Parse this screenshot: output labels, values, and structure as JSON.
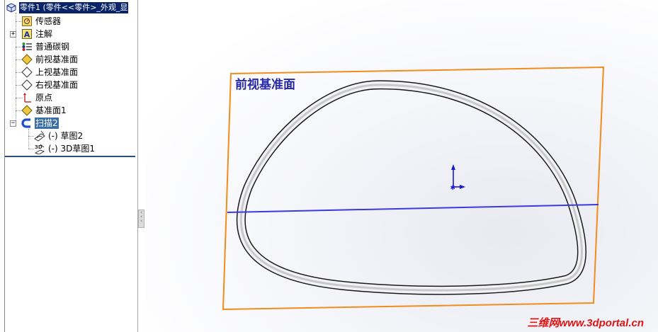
{
  "tree": {
    "root_label": "零件1  (零件<<零件>_外观_显",
    "items": [
      {
        "label": "传感器",
        "icon": "sensor-icon"
      },
      {
        "label": "注解",
        "icon": "annotation-icon"
      },
      {
        "label": "普通碳钢",
        "icon": "material-icon"
      },
      {
        "label": "前视基准面",
        "icon": "plane-icon"
      },
      {
        "label": "上视基准面",
        "icon": "plane-icon"
      },
      {
        "label": "右视基准面",
        "icon": "plane-icon"
      },
      {
        "label": "原点",
        "icon": "origin-icon"
      },
      {
        "label": "基准面1",
        "icon": "plane-icon"
      },
      {
        "label": "扫描2",
        "icon": "sweep-icon"
      }
    ],
    "sweep_children": [
      {
        "label": "(-) 草图2",
        "icon": "sketch-icon"
      },
      {
        "label": "(-) 3D草图1",
        "icon": "3d-sketch-icon"
      }
    ],
    "expanders": [
      "+",
      "+",
      "−"
    ]
  },
  "viewport": {
    "plane_label": "前视基准面",
    "watermark": "三维网www.3dportal.cn",
    "colors": {
      "plane_border": "#f28c1c",
      "plane_label": "#2626a8",
      "section_line": "#3a3ae0",
      "triad": "#1a1ad8",
      "watermark": "#e01414"
    }
  }
}
